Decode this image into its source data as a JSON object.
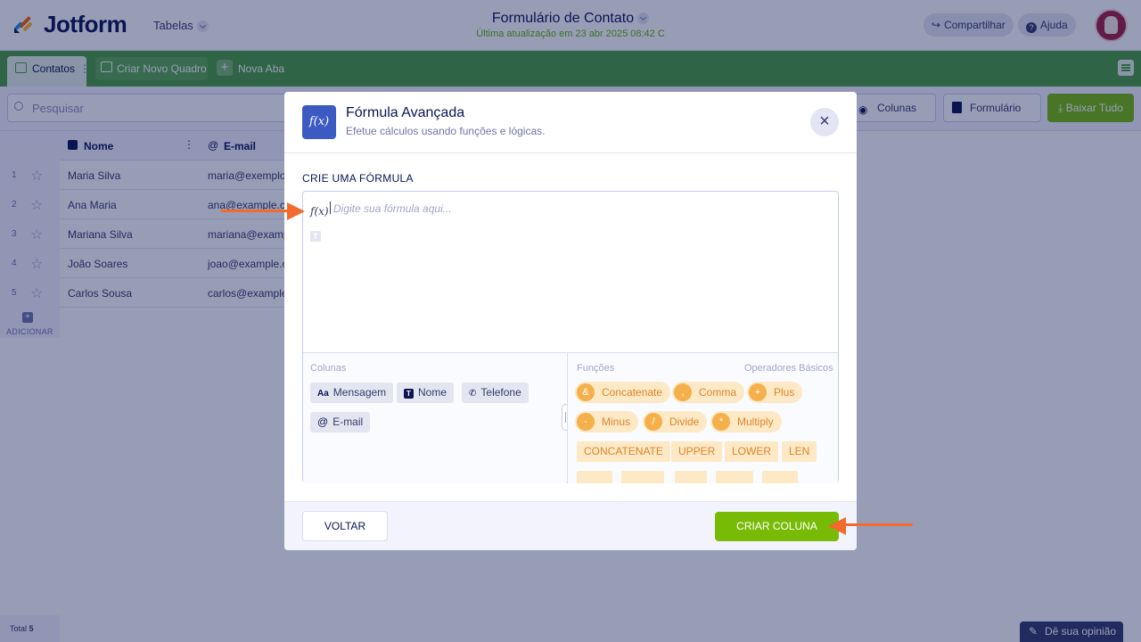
{
  "header": {
    "logo": "Jotform",
    "tables_menu": "Tabelas",
    "form_title": "Formulário de Contato",
    "last_updated": "Última atualização em 23 abr 2025 08:42 C",
    "share_label": "Compartilhar",
    "help_label": "Ajuda"
  },
  "tabs": {
    "active": "Contatos",
    "new_board": "Criar Novo Quadro",
    "new_tab": "Nova Aba"
  },
  "toolbar": {
    "search_placeholder": "Pesquisar",
    "columns_label": "Colunas",
    "form_label": "Formulário",
    "download_label": "Baixar Tudo"
  },
  "table": {
    "columns": [
      "Nome",
      "E-mail"
    ],
    "rows": [
      {
        "num": "1",
        "nome": "Maria Silva",
        "email": "maria@exemplo.co"
      },
      {
        "num": "2",
        "nome": "Ana Maria",
        "email": "ana@example.com"
      },
      {
        "num": "3",
        "nome": "Mariana Silva",
        "email": "mariana@example"
      },
      {
        "num": "4",
        "nome": "João Soares",
        "email": "joao@example.co"
      },
      {
        "num": "5",
        "nome": "Carlos Sousa",
        "email": "carlos@example.c"
      }
    ],
    "add_label": "ADICIONAR",
    "total_label": "Total",
    "total_value": "5"
  },
  "feedback_label": "Dê sua opinião",
  "modal": {
    "icon_text": "f(x)",
    "title": "Fórmula Avançada",
    "subtitle": "Efetue cálculos usando funções e lógicas.",
    "section_title": "CRIE UMA FÓRMULA",
    "fx_label": "f(x)",
    "formula_placeholder": "Digite sua fórmula aqui...",
    "columns_title": "Colunas",
    "column_chips": [
      "Mensagem",
      "Nome",
      "Telefone",
      "E-mail"
    ],
    "functions_title": "Funções",
    "operators_title": "Operadores Básicos",
    "operators": [
      {
        "symbol": "&",
        "label": "Concatenate"
      },
      {
        "symbol": ",",
        "label": "Comma"
      },
      {
        "symbol": "+",
        "label": "Plus"
      },
      {
        "symbol": "-",
        "label": "Minus"
      },
      {
        "symbol": "/",
        "label": "Divide"
      },
      {
        "symbol": "*",
        "label": "Multiply"
      }
    ],
    "functions": [
      "CONCATENATE",
      "UPPER",
      "LOWER",
      "LEN"
    ],
    "back_label": "VOLTAR",
    "create_label": "CRIAR COLUNA"
  },
  "colors": {
    "brand_green": "#78bb07",
    "tab_green": "#4c9e3f",
    "annotation_arrow": "#f26b2d",
    "function_chip": "#fde9c5"
  }
}
